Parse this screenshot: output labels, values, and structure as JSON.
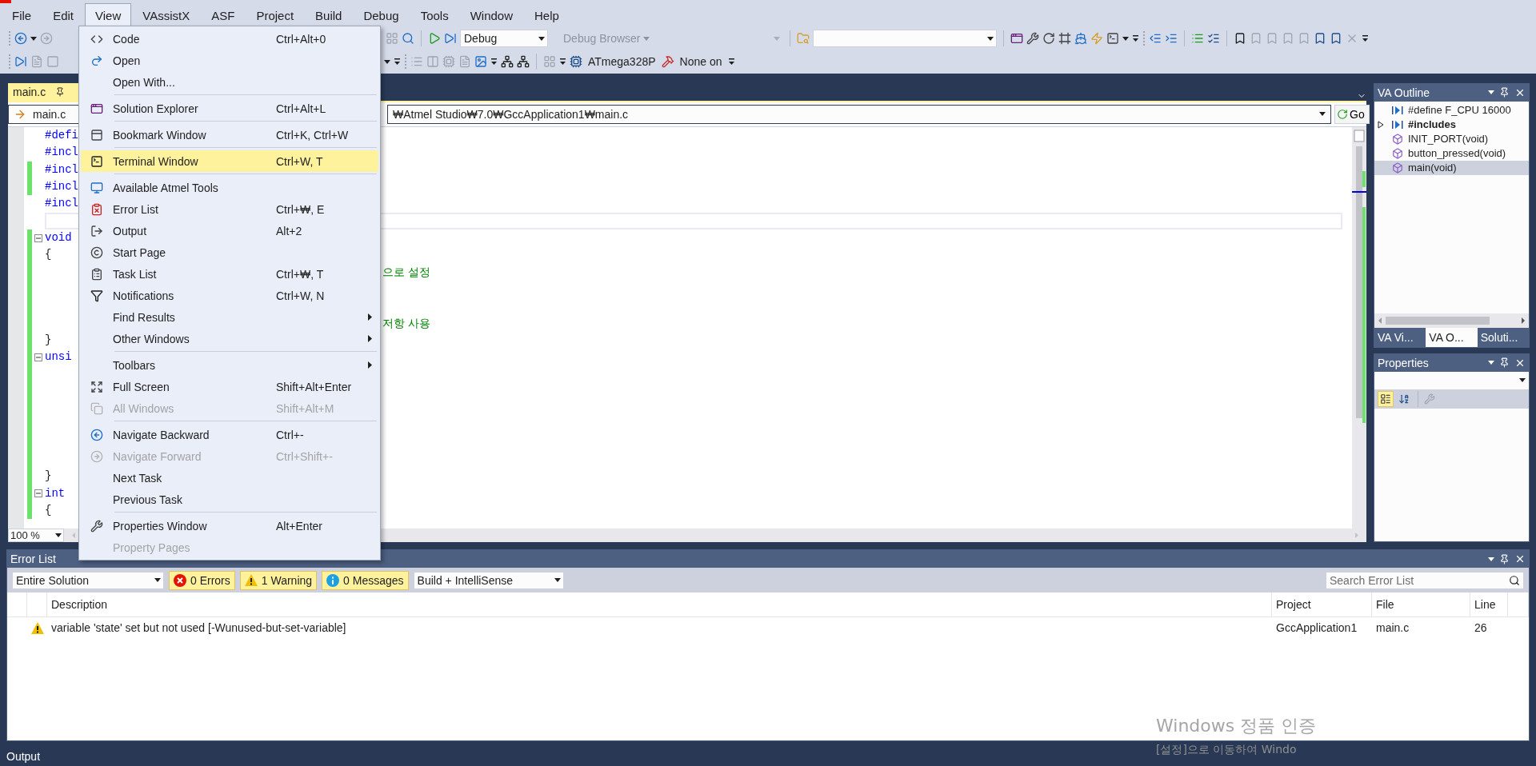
{
  "menu_bar": [
    {
      "label": "File",
      "selected": false
    },
    {
      "label": "Edit",
      "selected": false
    },
    {
      "label": "View",
      "selected": true
    },
    {
      "label": "VAssistX",
      "selected": false
    },
    {
      "label": "ASF",
      "selected": false
    },
    {
      "label": "Project",
      "selected": false
    },
    {
      "label": "Build",
      "selected": false
    },
    {
      "label": "Debug",
      "selected": false
    },
    {
      "label": "Tools",
      "selected": false
    },
    {
      "label": "Window",
      "selected": false
    },
    {
      "label": "Help",
      "selected": false
    }
  ],
  "toolbar": {
    "configuration": "Debug",
    "browser": "Debug Browser",
    "device": "ATmega328P",
    "tool": "None on"
  },
  "view_menu": {
    "items": [
      {
        "kind": "item",
        "label": "Code",
        "shortcut": "Ctrl+Alt+0",
        "disabled": false,
        "selected": false,
        "submenu": false
      },
      {
        "kind": "item",
        "label": "Open",
        "disabled": false,
        "selected": false,
        "submenu": false
      },
      {
        "kind": "item",
        "label": "Open With...",
        "disabled": false,
        "selected": false,
        "submenu": false
      },
      {
        "kind": "separator"
      },
      {
        "kind": "item",
        "label": "Solution Explorer",
        "shortcut": "Ctrl+Alt+L",
        "disabled": false,
        "selected": false,
        "submenu": false
      },
      {
        "kind": "separator"
      },
      {
        "kind": "item",
        "label": "Bookmark Window",
        "shortcut": "Ctrl+K, Ctrl+W",
        "disabled": false,
        "selected": false,
        "submenu": false
      },
      {
        "kind": "separator"
      },
      {
        "kind": "item",
        "label": "Terminal Window",
        "shortcut": "Ctrl+W, T",
        "disabled": false,
        "selected": true,
        "submenu": false
      },
      {
        "kind": "separator"
      },
      {
        "kind": "item",
        "label": "Available Atmel Tools",
        "disabled": false,
        "selected": false,
        "submenu": false
      },
      {
        "kind": "item",
        "label": "Error List",
        "shortcut": "Ctrl+₩, E",
        "disabled": false,
        "selected": false,
        "submenu": false
      },
      {
        "kind": "item",
        "label": "Output",
        "shortcut": "Alt+2",
        "disabled": false,
        "selected": false,
        "submenu": false
      },
      {
        "kind": "item",
        "label": "Start Page",
        "disabled": false,
        "selected": false,
        "submenu": false
      },
      {
        "kind": "item",
        "label": "Task List",
        "shortcut": "Ctrl+₩, T",
        "disabled": false,
        "selected": false,
        "submenu": false
      },
      {
        "kind": "item",
        "label": "Notifications",
        "shortcut": "Ctrl+W, N",
        "disabled": false,
        "selected": false,
        "submenu": false
      },
      {
        "kind": "item",
        "label": "Find Results",
        "disabled": false,
        "selected": false,
        "submenu": true
      },
      {
        "kind": "item",
        "label": "Other Windows",
        "disabled": false,
        "selected": false,
        "submenu": true
      },
      {
        "kind": "separator"
      },
      {
        "kind": "item",
        "label": "Toolbars",
        "disabled": false,
        "selected": false,
        "submenu": true
      },
      {
        "kind": "item",
        "label": "Full Screen",
        "shortcut": "Shift+Alt+Enter",
        "disabled": false,
        "selected": false,
        "submenu": false
      },
      {
        "kind": "item",
        "label": "All Windows",
        "shortcut": "Shift+Alt+M",
        "disabled": true,
        "selected": false,
        "submenu": false
      },
      {
        "kind": "separator"
      },
      {
        "kind": "item",
        "label": "Navigate Backward",
        "shortcut": "Ctrl+-",
        "disabled": false,
        "selected": false,
        "submenu": false
      },
      {
        "kind": "item",
        "label": "Navigate Forward",
        "shortcut": "Ctrl+Shift+-",
        "disabled": true,
        "selected": false,
        "submenu": false
      },
      {
        "kind": "item",
        "label": "Next Task",
        "disabled": false,
        "selected": false,
        "submenu": false
      },
      {
        "kind": "item",
        "label": "Previous Task",
        "disabled": false,
        "selected": false,
        "submenu": false
      },
      {
        "kind": "separator"
      },
      {
        "kind": "item",
        "label": "Properties Window",
        "shortcut": "Alt+Enter",
        "disabled": false,
        "selected": false,
        "submenu": false
      },
      {
        "kind": "item",
        "label": "Property Pages",
        "disabled": true,
        "selected": false,
        "submenu": false
      }
    ]
  },
  "document_tab": {
    "label": "main.c"
  },
  "navigation": {
    "file": "main.c",
    "path": "₩Atmel Studio₩7.0₩GccApplication1₩main.c",
    "go": "Go"
  },
  "editor": {
    "zoom": "100 %",
    "lines": [
      {
        "text": "#defi",
        "kind": "keyword",
        "changed": false,
        "fold": false,
        "current": false
      },
      {
        "text": "#incl",
        "kind": "keyword",
        "changed": false,
        "fold": false,
        "current": false
      },
      {
        "text": "#incl",
        "kind": "keyword",
        "changed": true,
        "fold": false,
        "current": false
      },
      {
        "text": "#incl",
        "kind": "keyword",
        "changed": true,
        "fold": false,
        "current": false
      },
      {
        "text": "#incl",
        "kind": "keyword",
        "changed": false,
        "fold": false,
        "current": false
      },
      {
        "changed": false,
        "fold": false,
        "current": true
      },
      {
        "text": "void",
        "kind": "keyword",
        "changed": true,
        "fold": true,
        "current": false
      },
      {
        "text": "{",
        "kind": "plain",
        "changed": true,
        "fold": false,
        "current": false
      },
      {
        "comment": "으로 설정",
        "changed": true,
        "fold": false,
        "current": false
      },
      {
        "changed": true,
        "fold": false,
        "current": false
      },
      {
        "changed": true,
        "fold": false,
        "current": false
      },
      {
        "comment": "저항 사용",
        "changed": true,
        "fold": false,
        "current": false
      },
      {
        "text": "}",
        "kind": "plain",
        "changed": true,
        "fold": false,
        "current": false
      },
      {
        "text": "unsi",
        "kind": "keyword",
        "changed": true,
        "fold": true,
        "current": false
      },
      {
        "changed": true,
        "fold": false,
        "current": false
      },
      {
        "changed": true,
        "fold": false,
        "current": false
      },
      {
        "changed": true,
        "fold": false,
        "current": false
      },
      {
        "changed": true,
        "fold": false,
        "current": false
      },
      {
        "changed": true,
        "fold": false,
        "current": false
      },
      {
        "changed": true,
        "fold": false,
        "current": false
      },
      {
        "text": "}",
        "kind": "plain",
        "changed": true,
        "fold": false,
        "current": false
      },
      {
        "text": "int",
        "kind": "keyword",
        "changed": true,
        "fold": true,
        "current": false
      },
      {
        "text": "{",
        "kind": "plain",
        "changed": true,
        "fold": false,
        "current": false
      }
    ]
  },
  "va_outline": {
    "title": "VA Outline",
    "items": [
      {
        "label": "#define F_CPU 16000",
        "kind": "macro",
        "selected": false
      },
      {
        "label": "#includes",
        "kind": "group",
        "expanded": false,
        "selected": false
      },
      {
        "label": "INIT_PORT(void)",
        "kind": "function",
        "selected": false
      },
      {
        "label": "button_pressed(void)",
        "kind": "function",
        "selected": false
      },
      {
        "label": "main(void)",
        "kind": "function",
        "selected": true
      }
    ],
    "tabs": [
      {
        "label": "VA Vi...",
        "selected": false
      },
      {
        "label": "VA O...",
        "selected": true
      },
      {
        "label": "Soluti...",
        "selected": false
      }
    ]
  },
  "properties": {
    "title": "Properties",
    "view_buttons": [
      {
        "selected": true
      },
      {
        "selected": false
      }
    ]
  },
  "error_list": {
    "title": "Error List",
    "scope": "Entire Solution",
    "filters": [
      {
        "label": "0 Errors",
        "kind": "error",
        "selected": true
      },
      {
        "label": "1 Warning",
        "kind": "warning",
        "selected": true
      },
      {
        "label": "0 Messages",
        "kind": "info",
        "selected": true
      }
    ],
    "source": "Build + IntelliSense",
    "search": {
      "placeholder": "Search Error List"
    },
    "columns": [
      "Description",
      "Project",
      "File",
      "Line"
    ],
    "rows": [
      {
        "kind": "warning",
        "description": "variable 'state' set but not used [-Wunused-but-set-variable]",
        "project": "GccApplication1",
        "file": "main.c",
        "line": "26"
      }
    ]
  },
  "status_bar": {
    "label": "Output"
  },
  "activation_notice": {
    "title": "Windows 정품 인증",
    "message": "[설정]으로 이동하여 Windo"
  }
}
